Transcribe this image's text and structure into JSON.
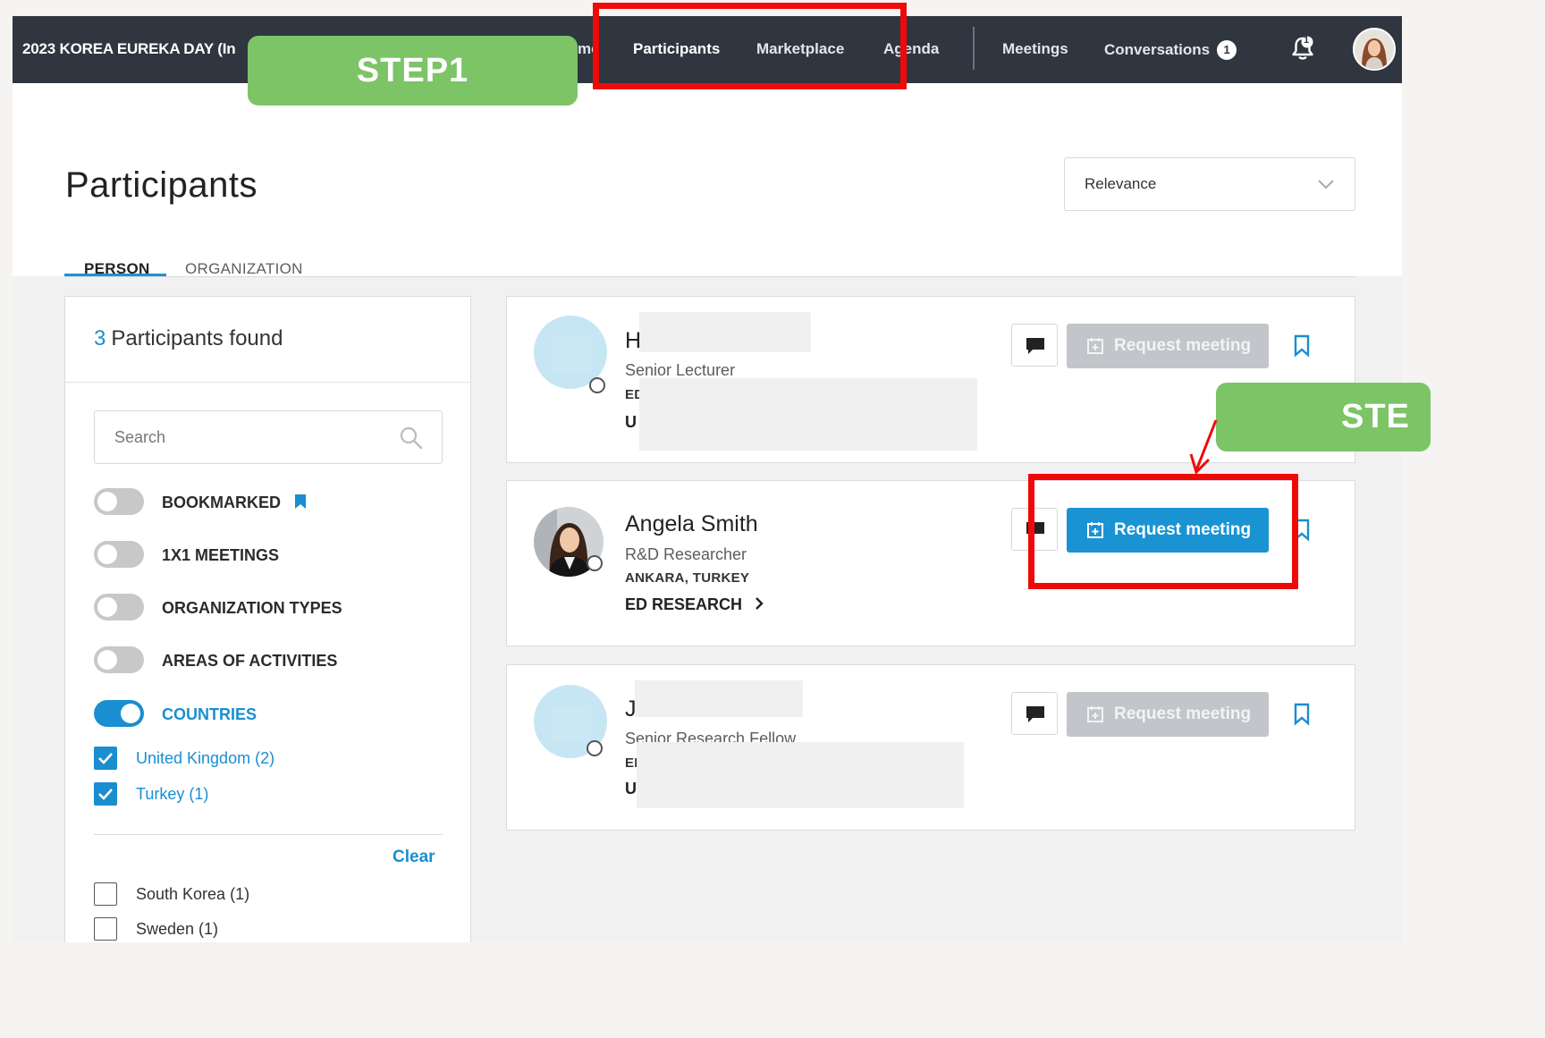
{
  "event": {
    "title": "2023 KOREA EUREKA DAY (In"
  },
  "nav": {
    "home_fragment": "me",
    "participants": "Participants",
    "marketplace": "Marketplace",
    "agenda": "Agenda",
    "meetings": "Meetings",
    "conversations": "Conversations",
    "conversations_badge": "1",
    "notifications_badge": "1"
  },
  "header": {
    "title": "Participants",
    "sort_value": "Relevance",
    "tabs": [
      "PERSON",
      "ORGANIZATION"
    ]
  },
  "filters": {
    "count": "3",
    "count_label": "Participants found",
    "search_placeholder": "Search",
    "toggles": [
      {
        "label": "BOOKMARKED",
        "on": false
      },
      {
        "label": "1X1 MEETINGS",
        "on": false
      },
      {
        "label": "ORGANIZATION TYPES",
        "on": false
      },
      {
        "label": "AREAS OF ACTIVITIES",
        "on": false
      },
      {
        "label": "COUNTRIES",
        "on": true
      }
    ],
    "selected_countries": [
      "United Kingdom (2)",
      "Turkey (1)"
    ],
    "clear_label": "Clear",
    "other_countries": [
      "South Korea (1)",
      "Sweden (1)"
    ]
  },
  "participants": [
    {
      "name_fragment": "H",
      "role": "Senior Lecturer",
      "loc_fragment": "ED",
      "org_fragment": "U",
      "request_label": "Request meeting",
      "enabled": false
    },
    {
      "name": "Angela Smith",
      "role": "R&D Researcher",
      "location": "ANKARA, TURKEY",
      "org": "ED RESEARCH",
      "request_label": "Request meeting",
      "enabled": true
    },
    {
      "name_fragment": "J",
      "role": "Senior Research Fellow",
      "loc_fragment": "EI",
      "org_fragment": "U",
      "request_label": "Request meeting",
      "enabled": false
    }
  ],
  "overlays": {
    "step1": "STEP1",
    "step2_fragment": "STE"
  },
  "colors": {
    "nav_bg": "#2f3640",
    "accent": "#1a93d2",
    "step_green": "#7cc466",
    "highlight_red": "#ef0a0a",
    "disabled_button": "#c2c5c9"
  }
}
